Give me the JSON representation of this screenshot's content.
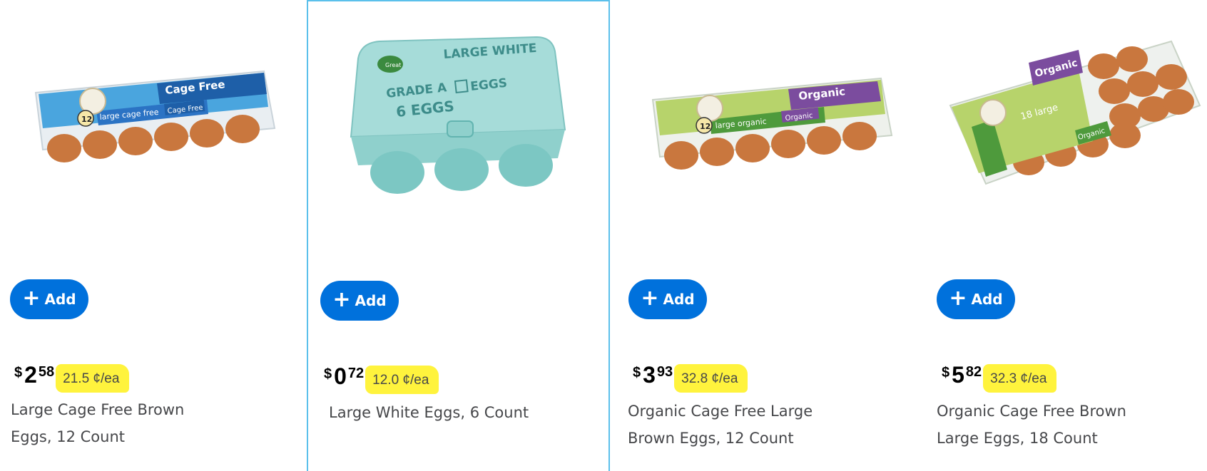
{
  "products": [
    {
      "add_label": "Add",
      "currency": "$",
      "dollars": "2",
      "cents": "58",
      "unit_price": "21.5 ¢/ea",
      "title_line1": "Large Cage Free Brown",
      "title_line2": "Eggs, 12 Count",
      "image_text": {
        "badge": "Cage Free",
        "count": "12",
        "label": "large cage free"
      }
    },
    {
      "add_label": "Add",
      "currency": "$",
      "dollars": "0",
      "cents": "72",
      "unit_price": "12.0 ¢/ea",
      "title_line1": "Large White Eggs, 6 Count",
      "title_line2": "",
      "image_text": {
        "top": "LARGE WHITE",
        "grade": "GRADE A",
        "eggs": "EGGS",
        "count": "6 EGGS"
      }
    },
    {
      "add_label": "Add",
      "currency": "$",
      "dollars": "3",
      "cents": "93",
      "unit_price": "32.8 ¢/ea",
      "title_line1": "Organic Cage Free Large",
      "title_line2": "Brown Eggs, 12 Count",
      "image_text": {
        "badge": "Organic",
        "count": "12",
        "label": "large organic"
      }
    },
    {
      "add_label": "Add",
      "currency": "$",
      "dollars": "5",
      "cents": "82",
      "unit_price": "32.3 ¢/ea",
      "title_line1": "Organic Cage Free Brown",
      "title_line2": "Large Eggs, 18 Count",
      "image_text": {
        "badge": "Organic",
        "count": "18",
        "label": "18 large"
      }
    }
  ],
  "colors": {
    "add_button": "#0071dc",
    "highlight": "#fff22d",
    "selected_border": "#5bc0eb"
  },
  "icons": [
    "plus-icon"
  ]
}
